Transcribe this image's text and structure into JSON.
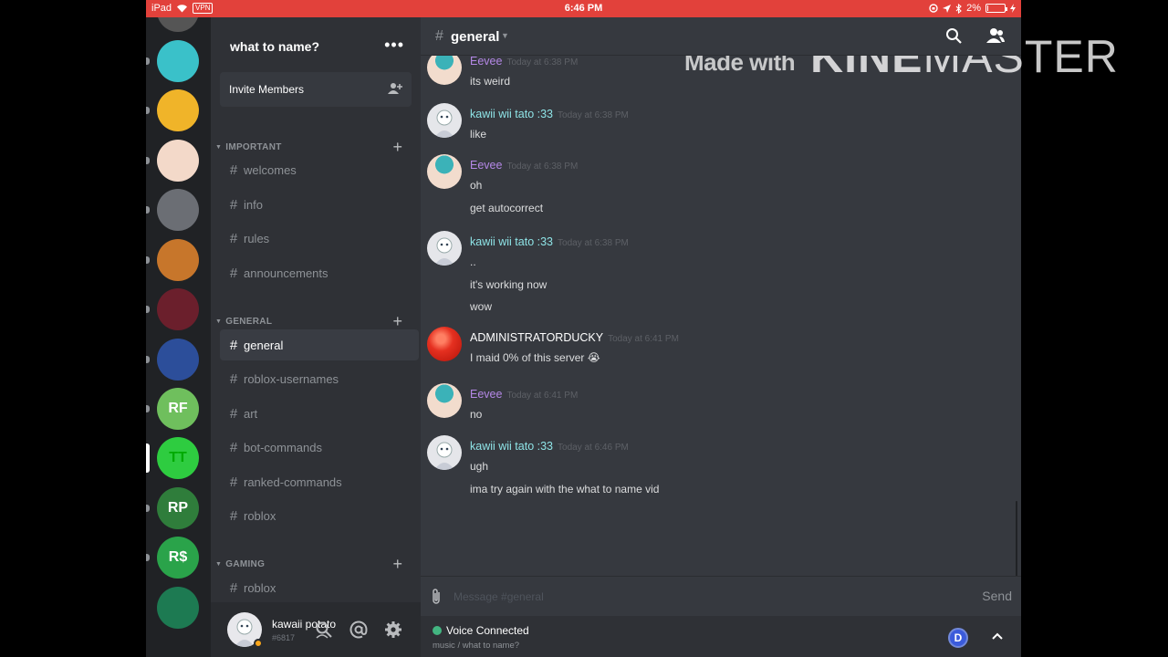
{
  "status_bar": {
    "device": "iPad",
    "vpn": "VPN",
    "time": "6:46 PM",
    "battery": "2%",
    "battery_level": 0.02
  },
  "server": {
    "name": "what to name?",
    "menu": "•••",
    "invite_label": "Invite Members"
  },
  "servers": [
    {
      "label": "",
      "bg": "#3ac1c9",
      "color": "#fff"
    },
    {
      "label": "",
      "bg": "#f0b429",
      "color": "#fff"
    },
    {
      "label": "",
      "bg": "#f3d9c9",
      "color": "#fff"
    },
    {
      "label": "",
      "bg": "#6b6e74",
      "color": "#fff"
    },
    {
      "label": "",
      "bg": "#c7762b",
      "color": "#fff"
    },
    {
      "label": "",
      "bg": "#6b1f2c",
      "color": "#fff"
    },
    {
      "label": "",
      "bg": "#2c4e9a",
      "color": "#fff"
    },
    {
      "label": "RF",
      "bg": "#6fbf5d",
      "color": "#fff"
    },
    {
      "label": "TT",
      "bg": "#2ecc40",
      "color": "#0a0"
    },
    {
      "label": "RP",
      "bg": "#2f7d3b",
      "color": "#fff"
    },
    {
      "label": "R$",
      "bg": "#2aa34a",
      "color": "#fff"
    }
  ],
  "categories": [
    {
      "name": "IMPORTANT",
      "channels": [
        "welcomes",
        "info",
        "rules",
        "announcements"
      ]
    },
    {
      "name": "GENERAL",
      "channels": [
        "general",
        "roblox-usernames",
        "art",
        "bot-commands",
        "ranked-commands",
        "roblox"
      ]
    },
    {
      "name": "GAMING",
      "channels": [
        "roblox"
      ]
    }
  ],
  "user": {
    "name": "kawaii potato",
    "tag": "#6817"
  },
  "chat": {
    "channel": "general",
    "placeholder": "Message #general",
    "send_label": "Send",
    "messages": [
      {
        "author": "Eevee",
        "author_color": "#b488e6",
        "time": "Today at 6:38 PM",
        "lines": [
          "its weird"
        ]
      },
      {
        "author": "kawii wii tato :33",
        "author_color": "#8ee3e6",
        "time": "Today at 6:38 PM",
        "lines": [
          "like"
        ]
      },
      {
        "author": "Eevee",
        "author_color": "#b488e6",
        "time": "Today at 6:38 PM",
        "lines": [
          "oh",
          "get autocorrect"
        ]
      },
      {
        "author": "kawii wii tato :33",
        "author_color": "#8ee3e6",
        "time": "Today at 6:38 PM",
        "lines": [
          "..",
          "it's working now",
          "wow"
        ]
      },
      {
        "author": "ADMINISTRATORDUCKY",
        "author_color": "#ffffff",
        "time": "Today at 6:41 PM",
        "lines": [
          "I maid 0% of this server 😭"
        ]
      },
      {
        "author": "Eevee",
        "author_color": "#b488e6",
        "time": "Today at 6:41 PM",
        "lines": [
          "no"
        ]
      },
      {
        "author": "kawii wii tato :33",
        "author_color": "#8ee3e6",
        "time": "Today at 6:46 PM",
        "lines": [
          "ugh",
          "ima try again with the what to name vid"
        ]
      }
    ]
  },
  "voice": {
    "title": "Voice Connected",
    "subtitle": "music / what to name?",
    "avatar_letter": "D"
  },
  "watermark": {
    "made": "Made with",
    "brand_a": "KINE",
    "brand_b": "MASTER"
  }
}
